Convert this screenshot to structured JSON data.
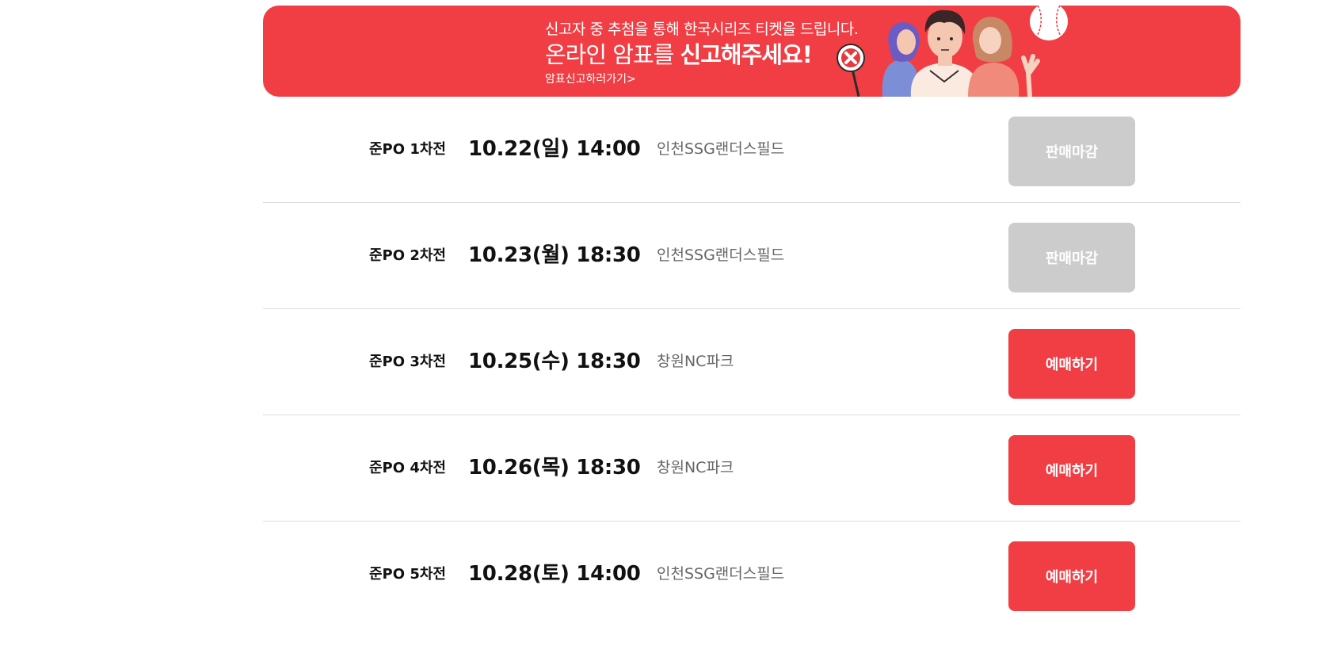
{
  "banner": {
    "line1": "신고자 중 추첨을 통해 한국시리즈 티켓을 드립니다.",
    "line2_light": "온라인 암표를 ",
    "line2_bold": "신고해주세요!",
    "link": "암표신고하러가기>",
    "background": "#f03e44"
  },
  "games": [
    {
      "name": "준PO 1차전",
      "datetime": "10.22(일) 14:00",
      "venue": "인천SSG랜더스필드",
      "button": "판매마감",
      "status": "closed"
    },
    {
      "name": "준PO 2차전",
      "datetime": "10.23(월) 18:30",
      "venue": "인천SSG랜더스필드",
      "button": "판매마감",
      "status": "closed"
    },
    {
      "name": "준PO 3차전",
      "datetime": "10.25(수) 18:30",
      "venue": "창원NC파크",
      "button": "예매하기",
      "status": "open"
    },
    {
      "name": "준PO 4차전",
      "datetime": "10.26(목) 18:30",
      "venue": "창원NC파크",
      "button": "예매하기",
      "status": "open"
    },
    {
      "name": "준PO 5차전",
      "datetime": "10.28(토) 14:00",
      "venue": "인천SSG랜더스필드",
      "button": "예매하기",
      "status": "open"
    }
  ],
  "colors": {
    "accent": "#f03e44",
    "closed": "#cccccc"
  }
}
